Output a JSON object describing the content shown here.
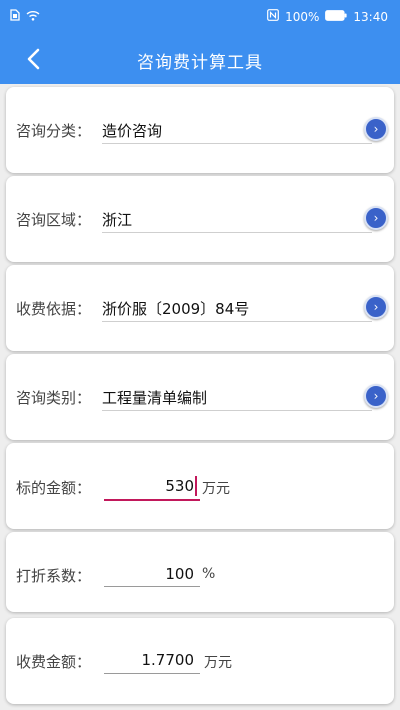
{
  "status": {
    "battery_text": "100%",
    "time": "13:40",
    "icons": [
      "sim-icon",
      "wifi-icon",
      "nfc-icon",
      "battery-icon"
    ]
  },
  "header": {
    "title": "咨询费计算工具",
    "back_icon": "back-arrow-icon"
  },
  "colors": {
    "primary": "#3d8ff0",
    "arrow_button": "#3a62c9",
    "active_underline": "#c2185b"
  },
  "fields": {
    "category": {
      "label": "咨询分类：",
      "value": "造价咨询"
    },
    "region": {
      "label": "咨询区域：",
      "value": "浙江"
    },
    "basis": {
      "label": "收费依据：",
      "value": "浙价服〔2009〕84号"
    },
    "type": {
      "label": "咨询类别：",
      "value": "工程量清单编制"
    },
    "amount": {
      "label": "标的金额：",
      "value": "530",
      "unit": "万元"
    },
    "discount": {
      "label": "打折系数：",
      "value": "100",
      "unit": "%"
    },
    "fee": {
      "label": "收费金额：",
      "value": "1.7700",
      "unit": "万元"
    }
  }
}
